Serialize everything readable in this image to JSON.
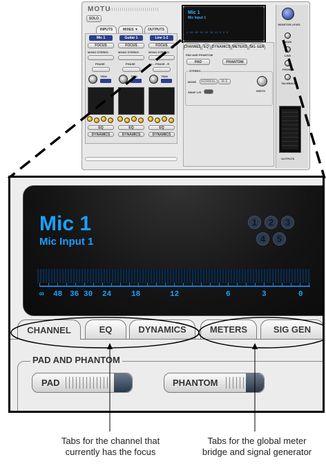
{
  "mini": {
    "logo": "MOTU",
    "solo_label": "SOLO",
    "tabs": [
      "INPUTS",
      "MIXES ▼",
      "OUTPUTS"
    ],
    "channels": [
      {
        "name": "Mic 1",
        "focus": "FOCUS",
        "mode": "MONO STEREO",
        "phase": "PHASE",
        "trim": "TRIM",
        "eq": "EQ",
        "dyn": "DYNAMICS"
      },
      {
        "name": "Guitar 1",
        "focus": "FOCUS",
        "mode": "MONO STEREO",
        "phase": "PHASE",
        "trim": "TRIM",
        "eq": "EQ",
        "dyn": "DYNAMICS"
      },
      {
        "name": "Line 1-2",
        "focus": "FOCUS",
        "mode": "MONO STEREO",
        "phase": "L - PHASE - R",
        "trim": "TRIM",
        "eq": "EQ",
        "dyn": "DYNAMICS"
      }
    ],
    "lcd_title": "Mic 1",
    "lcd_sub": "Mic Input 1",
    "lcd_scale": "∞ 48 36 30 24 18 12 6 3 0",
    "tabs2": [
      "CHANNEL",
      "EQ",
      "DYNAMICS",
      "METERS",
      "SIG GEN"
    ],
    "pad_phantom": "PAD AND PHANTOM",
    "pad": "PAD",
    "phantom": "PHANTOM",
    "stereo": "STEREO",
    "mode_lbl": "MODE",
    "mode_vals": [
      "NORMAL",
      "M-S"
    ],
    "width": "WIDTH",
    "swap": "SWAP L/R",
    "side": [
      "MONITOR LEVEL",
      "MAIN",
      "LINE",
      "PHONES",
      "TALKBACK"
    ],
    "outputs": "OUTPUTS"
  },
  "zoom": {
    "channel_title": "Mic 1",
    "channel_sub": "Mic Input 1",
    "input_circles": [
      "1",
      "2",
      "3",
      "4",
      "5"
    ],
    "scale": [
      "∞",
      "48",
      "36",
      "30",
      "24",
      "18",
      "12",
      "6",
      "3",
      "0"
    ],
    "tabs": [
      "CHANNEL",
      "EQ",
      "DYNAMICS",
      "METERS",
      "SIG GEN"
    ],
    "group_label": "PAD AND PHANTOM",
    "pad_label": "PAD",
    "phantom_label": "PHANTOM"
  },
  "captions": {
    "left": [
      "Tabs for the channel that",
      "currently has the focus"
    ],
    "right": [
      "Tabs for the global meter",
      "bridge and signal generator"
    ]
  },
  "colors": {
    "lcd_text": "#1aa0ff",
    "channel_name_bg": "#2a3f8f"
  }
}
